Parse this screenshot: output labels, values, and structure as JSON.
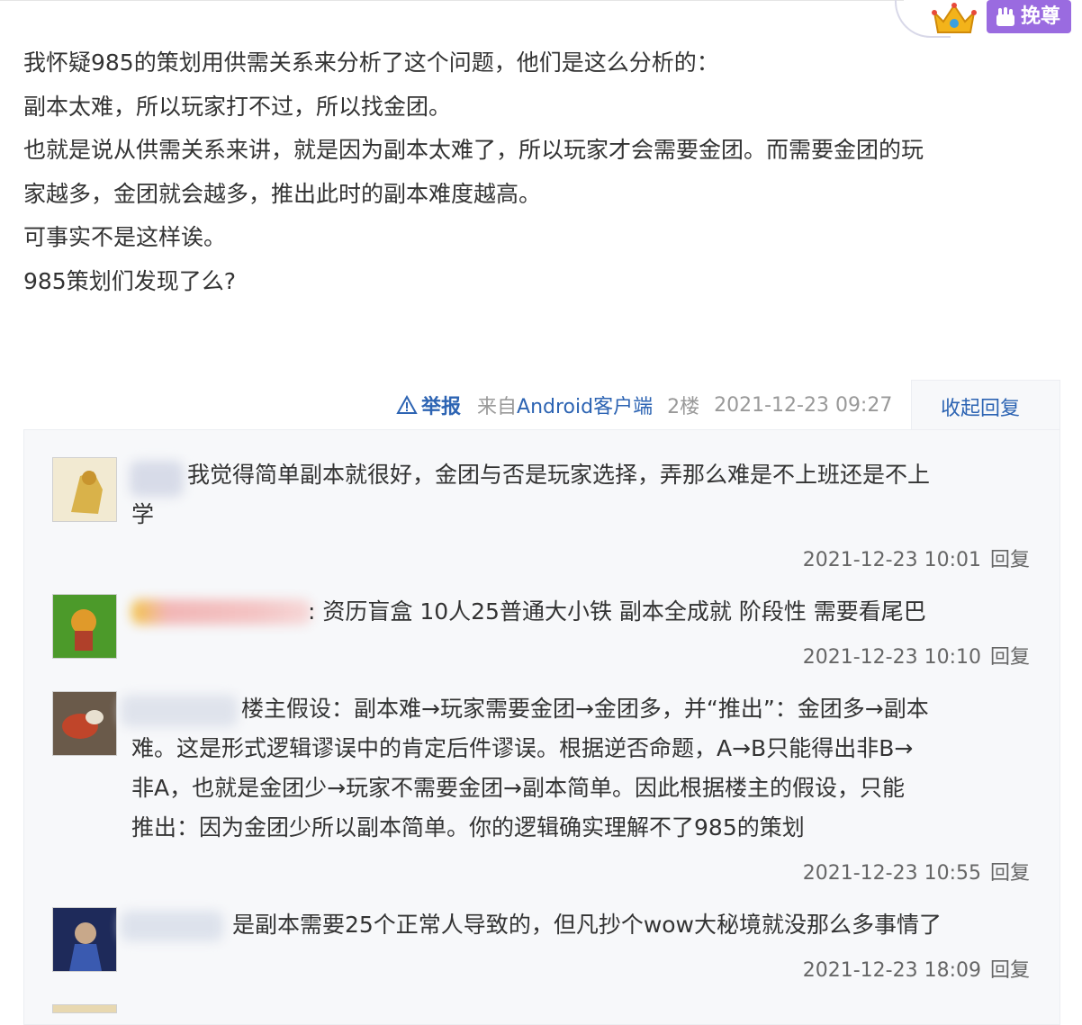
{
  "badge": {
    "crown_icon": "crown-icon",
    "recommend_label": "挽尊"
  },
  "post": {
    "lines": [
      "我怀疑985的策划用供需关系来分析了这个问题，他们是这么分析的：",
      "副本太难，所以玩家打不过，所以找金团。",
      "也就是说从供需关系来讲，就是因为副本太难了，所以玩家才会需要金团。而需要金团的玩",
      "家越多，金团就会越多，推出此时的副本难度越高。",
      "可事实不是这样诶。",
      "985策划们发现了么?"
    ]
  },
  "post_meta": {
    "report_label": "举报",
    "source_prefix": "来自",
    "source_client": "Android客户端",
    "floor": "2楼",
    "datetime": "2021-12-23 09:27",
    "collapse_label": "收起回复"
  },
  "replies": [
    {
      "line1": "我觉得简单副本就很好，金团与否是玩家选择，弄那么难是不上班还是不上",
      "line2": "学",
      "time": "2021-12-23 10:01",
      "reply_label": "回复"
    },
    {
      "line1": ": 资历盲盒 10人25普通大小铁 副本全成就 阶段性 需要看尾巴",
      "time": "2021-12-23 10:10",
      "reply_label": "回复"
    },
    {
      "line1": "楼主假设：副本难→玩家需要金团→金团多，并“推出”：金团多→副本",
      "line2": "难。这是形式逻辑谬误中的肯定后件谬误。根据逆否命题，A→B只能得出非B→",
      "line3": "非A，也就是金团少→玩家不需要金团→副本简单。因此根据楼主的假设，只能",
      "line4": "推出：因为金团少所以副本简单。你的逻辑确实理解不了985的策划",
      "time": "2021-12-23 10:55",
      "reply_label": "回复"
    },
    {
      "line1": "是副本需要25个正常人导致的，但凡抄个wow大秘境就没那么多事情了",
      "time": "2021-12-23 18:09",
      "reply_label": "回复"
    }
  ],
  "colors": {
    "link": "#2d64b3",
    "badge": "#9a6be0",
    "reply_bg": "#f7f8fa"
  }
}
